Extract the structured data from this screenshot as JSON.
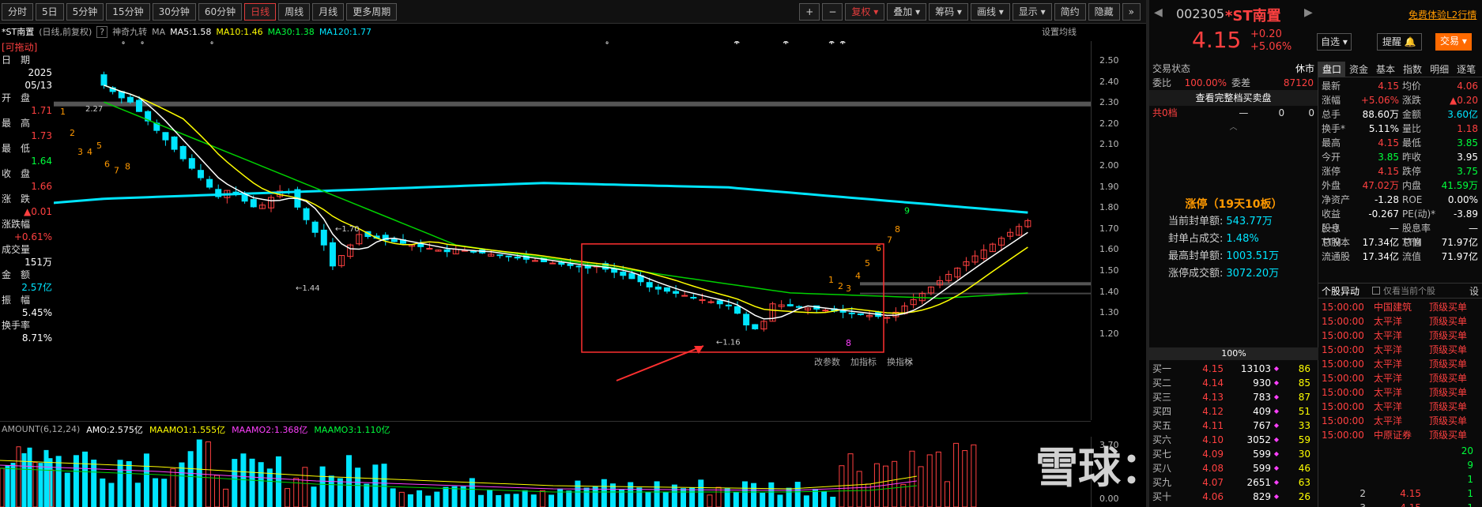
{
  "toolbar": {
    "periods": [
      "分时",
      "5日",
      "5分钟",
      "15分钟",
      "30分钟",
      "60分钟",
      "日线",
      "周线",
      "月线",
      "更多周期"
    ],
    "active_index": 6,
    "right_buttons": [
      "+",
      "−",
      "复权",
      "叠加",
      "筹码",
      "画线",
      "显示",
      "简约",
      "隐藏"
    ],
    "expand": "»"
  },
  "ma_bar": {
    "name": "*ST南置",
    "mode": "(日线,前复权)",
    "help": "?",
    "indicator": "神奇九转",
    "ma": "MA",
    "ma5": "MA5:1.58",
    "ma10": "MA10:1.46",
    "ma30": "MA30:1.38",
    "ma120": "MA120:1.77",
    "settings": "设置均线"
  },
  "left_panel": {
    "draggable": "[可拖动]",
    "date_label": "日　期",
    "year": "2025",
    "date": "05/13",
    "open_label": "开　盘",
    "open": "1.71",
    "high_label": "最　高",
    "high": "1.73",
    "low_label": "最　低",
    "low": "1.64",
    "close_label": "收　盘",
    "close": "1.66",
    "change_label": "涨　跌",
    "change": "▲0.01",
    "pct_label": "涨跌幅",
    "pct": "+0.61%",
    "vol_label": "成交量",
    "vol": "151万",
    "amt_label": "金　额",
    "amt": "2.57亿",
    "amp_label": "振　幅",
    "amp": "5.45%",
    "turn_label": "换手率",
    "turn": "8.71%"
  },
  "price_axis": [
    "2.50",
    "2.40",
    "2.30",
    "2.20",
    "2.10",
    "2.00",
    "1.90",
    "1.80",
    "1.70",
    "1.60",
    "1.50",
    "1.40",
    "1.30",
    "1.20"
  ],
  "annotations": {
    "hi_label": "2.27",
    "mid_label": "←1.70",
    "low1_label": "←1.44",
    "low2_label": "←1.16",
    "nine_count": [
      "1",
      "2",
      "3",
      "4",
      "5",
      "6",
      "7",
      "8"
    ],
    "nine_count_late": [
      "1",
      "2",
      "3",
      "4",
      "5",
      "6",
      "7",
      "8",
      "9"
    ],
    "magenta_mark": "8",
    "chart_buttons": [
      "改参数",
      "加指标",
      "换指标"
    ],
    "close_x": "×"
  },
  "amount_bar": {
    "name": "AMOUNT(6,12,24)",
    "amo": "AMO:2.575亿",
    "m1": "MAAMO1:1.555亿",
    "m2": "MAAMO2:1.368亿",
    "m3": "MAAMO3:1.110亿"
  },
  "vol_axis": [
    "3.70",
    "0.00"
  ],
  "watermark": "雪球：价值投资",
  "header": {
    "code": "002305",
    "name": "*ST南置",
    "free_l2": "免费体验L2行情",
    "price": "4.15",
    "change": "+0.20",
    "pct": "+5.06%",
    "watch": "自选",
    "remind": "提醒",
    "trade": "交易"
  },
  "mid": {
    "status_label": "交易状态",
    "status": "休市",
    "wb_label": "委比",
    "wb": "100.00%",
    "wc_label": "委差",
    "wc": "87120",
    "full_book": "查看完整档买卖盘",
    "total_label": "共0档",
    "total_dash": "—",
    "total_a": "0",
    "total_b": "0",
    "limit_title": "涨停（19天10板）",
    "limit_rows": [
      {
        "k": "当前封单额:",
        "v": "543.77万"
      },
      {
        "k": "封单占成交:",
        "v": "1.48%"
      },
      {
        "k": "最高封单额:",
        "v": "1003.51万"
      },
      {
        "k": "涨停成交额:",
        "v": "3072.20万"
      }
    ],
    "pct_bar": "100%",
    "bids": [
      {
        "k": "买一",
        "p": "4.15",
        "v": "13103",
        "n": "86"
      },
      {
        "k": "买二",
        "p": "4.14",
        "v": "930",
        "n": "85"
      },
      {
        "k": "买三",
        "p": "4.13",
        "v": "783",
        "n": "87"
      },
      {
        "k": "买四",
        "p": "4.12",
        "v": "409",
        "n": "51"
      },
      {
        "k": "买五",
        "p": "4.11",
        "v": "767",
        "n": "33"
      },
      {
        "k": "买六",
        "p": "4.10",
        "v": "3052",
        "n": "59"
      },
      {
        "k": "买七",
        "p": "4.09",
        "v": "599",
        "n": "30"
      },
      {
        "k": "买八",
        "p": "4.08",
        "v": "599",
        "n": "46"
      },
      {
        "k": "买九",
        "p": "4.07",
        "v": "2651",
        "n": "63"
      },
      {
        "k": "买十",
        "p": "4.06",
        "v": "829",
        "n": "26"
      }
    ]
  },
  "right": {
    "tabs": [
      "盘口",
      "资金",
      "基本",
      "指数",
      "明细",
      "逐笔"
    ],
    "quotes": [
      {
        "k": "最新",
        "v": "4.15",
        "c": "red",
        "k2": "均价",
        "v2": "4.06",
        "c2": "red"
      },
      {
        "k": "涨幅",
        "v": "+5.06%",
        "c": "red",
        "k2": "涨跌",
        "v2": "▲0.20",
        "c2": "red"
      },
      {
        "k": "总手",
        "v": "88.60万",
        "c": "white",
        "k2": "金额",
        "v2": "3.60亿",
        "c2": "cyan"
      },
      {
        "k": "换手*",
        "v": "5.11%",
        "c": "white",
        "k2": "量比",
        "v2": "1.18",
        "c2": "red"
      },
      {
        "k": "最高",
        "v": "4.15",
        "c": "red",
        "k2": "最低",
        "v2": "3.85",
        "c2": "green"
      },
      {
        "k": "今开",
        "v": "3.85",
        "c": "green",
        "k2": "昨收",
        "v2": "3.95",
        "c2": "white"
      },
      {
        "k": "涨停",
        "v": "4.15",
        "c": "red",
        "k2": "跌停",
        "v2": "3.75",
        "c2": "green"
      },
      {
        "k": "外盘",
        "v": "47.02万",
        "c": "red",
        "k2": "内盘",
        "v2": "41.59万",
        "c2": "green"
      },
      {
        "k": "净资产",
        "v": "-1.28",
        "c": "white",
        "k2": "ROE",
        "v2": "0.00%",
        "c2": "white"
      },
      {
        "k": "收益(一)",
        "v": "-0.267",
        "c": "white",
        "k2": "PE(动)*",
        "v2": "-3.89",
        "c2": "white"
      },
      {
        "k": "股息TTM",
        "v": "—",
        "c": "white",
        "k2": "股息率TTM",
        "v2": "—",
        "c2": "white"
      },
      {
        "k": "总股本",
        "v": "17.34亿",
        "c": "white",
        "k2": "总值",
        "v2": "71.97亿",
        "c2": "white"
      },
      {
        "k": "流通股",
        "v": "17.34亿",
        "c": "white",
        "k2": "流值",
        "v2": "71.97亿",
        "c2": "white"
      }
    ],
    "move_title": "个股异动",
    "move_check": "仅看当前个股",
    "move_set": "设",
    "moves": [
      {
        "t": "15:00:00",
        "who": "中国建筑",
        "what": "顶级买单"
      },
      {
        "t": "15:00:00",
        "who": "太平洋",
        "what": "顶级买单"
      },
      {
        "t": "15:00:00",
        "who": "太平洋",
        "what": "顶级买单"
      },
      {
        "t": "15:00:00",
        "who": "太平洋",
        "what": "顶级买单"
      },
      {
        "t": "15:00:00",
        "who": "太平洋",
        "what": "顶级买单"
      },
      {
        "t": "15:00:00",
        "who": "太平洋",
        "what": "顶级买单"
      },
      {
        "t": "15:00:00",
        "who": "太平洋",
        "what": "顶级买单"
      },
      {
        "t": "15:00:00",
        "who": "太平洋",
        "what": "顶级买单"
      },
      {
        "t": "15:00:00",
        "who": "太平洋",
        "what": "顶级买单"
      },
      {
        "t": "15:00:00",
        "who": "中原证券",
        "what": "顶级买单"
      }
    ],
    "ticks": [
      {
        "a": "",
        "b": "",
        "c": "20"
      },
      {
        "a": "",
        "b": "",
        "c": "9"
      },
      {
        "a": "",
        "b": "",
        "c": "1"
      },
      {
        "a": "2",
        "b": "4.15",
        "c": "1"
      },
      {
        "a": "3",
        "b": "4.15",
        "c": "1"
      }
    ]
  },
  "colors": {
    "up": "#ff4040",
    "down": "#00e5ff",
    "ma5": "#ffffff",
    "ma10": "#ffff00",
    "ma30": "#00d000",
    "ma120": "#00e5ff"
  }
}
